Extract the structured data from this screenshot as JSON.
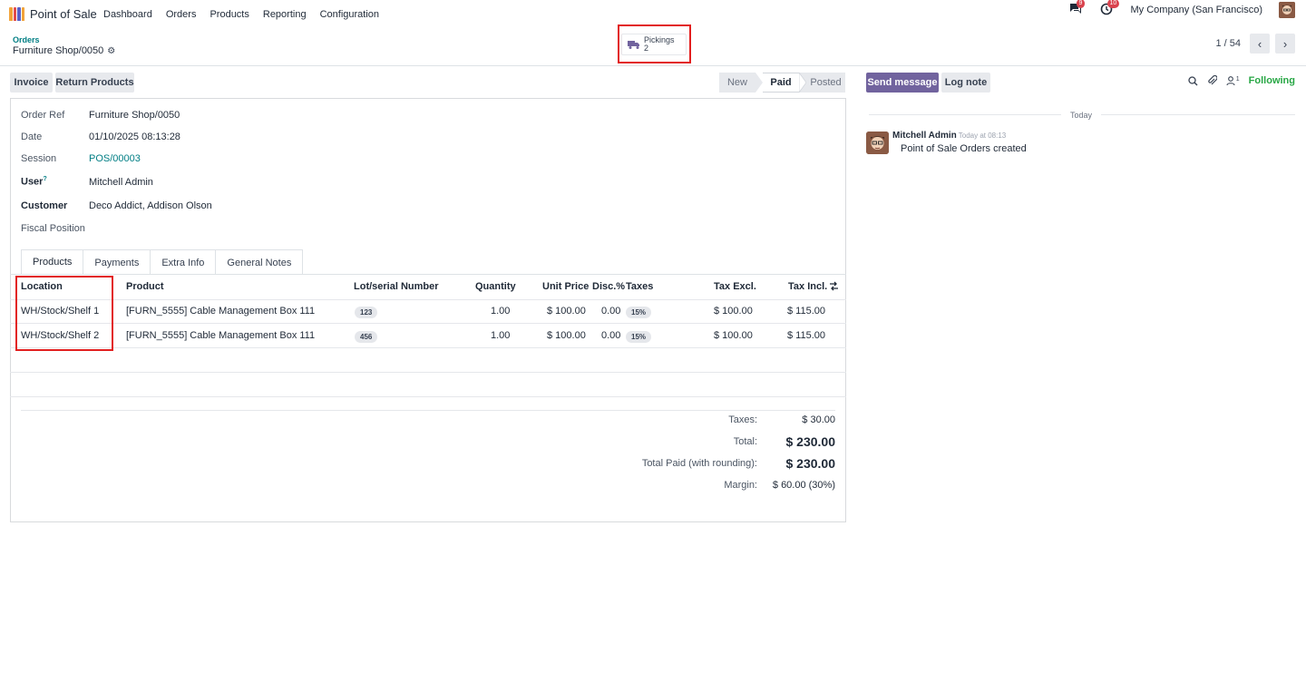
{
  "navbar": {
    "app_name": "Point of Sale",
    "menu": [
      "Dashboard",
      "Orders",
      "Products",
      "Reporting",
      "Configuration"
    ],
    "messages_count": "9",
    "activities_count": "10",
    "company": "My Company (San Francisco)"
  },
  "breadcrumb": {
    "parent": "Orders",
    "current": "Furniture Shop/0050"
  },
  "smart_button": {
    "label": "Pickings",
    "count": "2"
  },
  "pager": {
    "text": "1 / 54"
  },
  "actions": {
    "invoice": "Invoice",
    "return_products": "Return Products"
  },
  "status": {
    "stages": [
      "New",
      "Paid",
      "Posted"
    ],
    "active": "Paid"
  },
  "form": {
    "order_ref_label": "Order Ref",
    "order_ref": "Furniture Shop/0050",
    "date_label": "Date",
    "date": "01/10/2025 08:13:28",
    "session_label": "Session",
    "session": "POS/00003",
    "user_label": "User",
    "user_help": "?",
    "user": "Mitchell Admin",
    "customer_label": "Customer",
    "customer": "Deco Addict, Addison Olson",
    "fiscal_position_label": "Fiscal Position"
  },
  "tabs": [
    "Products",
    "Payments",
    "Extra Info",
    "General Notes"
  ],
  "table": {
    "headers": {
      "location": "Location",
      "product": "Product",
      "lot": "Lot/serial Number",
      "quantity": "Quantity",
      "unit_price": "Unit Price",
      "discount": "Disc.%",
      "taxes": "Taxes",
      "tax_excl": "Tax Excl.",
      "tax_incl": "Tax Incl."
    },
    "rows": [
      {
        "location": "WH/Stock/Shelf 1",
        "product": "[FURN_5555] Cable Management Box 111",
        "lot": "123",
        "quantity": "1.00",
        "unit_price": "$ 100.00",
        "discount": "0.00",
        "taxes": "15%",
        "tax_excl": "$ 100.00",
        "tax_incl": "$ 115.00"
      },
      {
        "location": "WH/Stock/Shelf 2",
        "product": "[FURN_5555] Cable Management Box 111",
        "lot": "456",
        "quantity": "1.00",
        "unit_price": "$ 100.00",
        "discount": "0.00",
        "taxes": "15%",
        "tax_excl": "$ 100.00",
        "tax_incl": "$ 115.00"
      }
    ]
  },
  "totals": {
    "taxes_label": "Taxes:",
    "taxes": "$ 30.00",
    "total_label": "Total:",
    "total": "$ 230.00",
    "paid_label": "Total Paid (with rounding):",
    "paid": "$ 230.00",
    "margin_label": "Margin:",
    "margin": "$ 60.00 (30%)"
  },
  "chatter": {
    "send_message": "Send message",
    "log_note": "Log note",
    "followers_count": "1",
    "following": "Following",
    "date_separator": "Today",
    "message": {
      "author": "Mitchell Admin",
      "date": "Today at 08:13",
      "body": "Point of Sale Orders created"
    }
  },
  "colors": {
    "accent": "#017e84",
    "primary": "#71639e",
    "highlight": "#e21f1f",
    "following": "#28a745"
  }
}
